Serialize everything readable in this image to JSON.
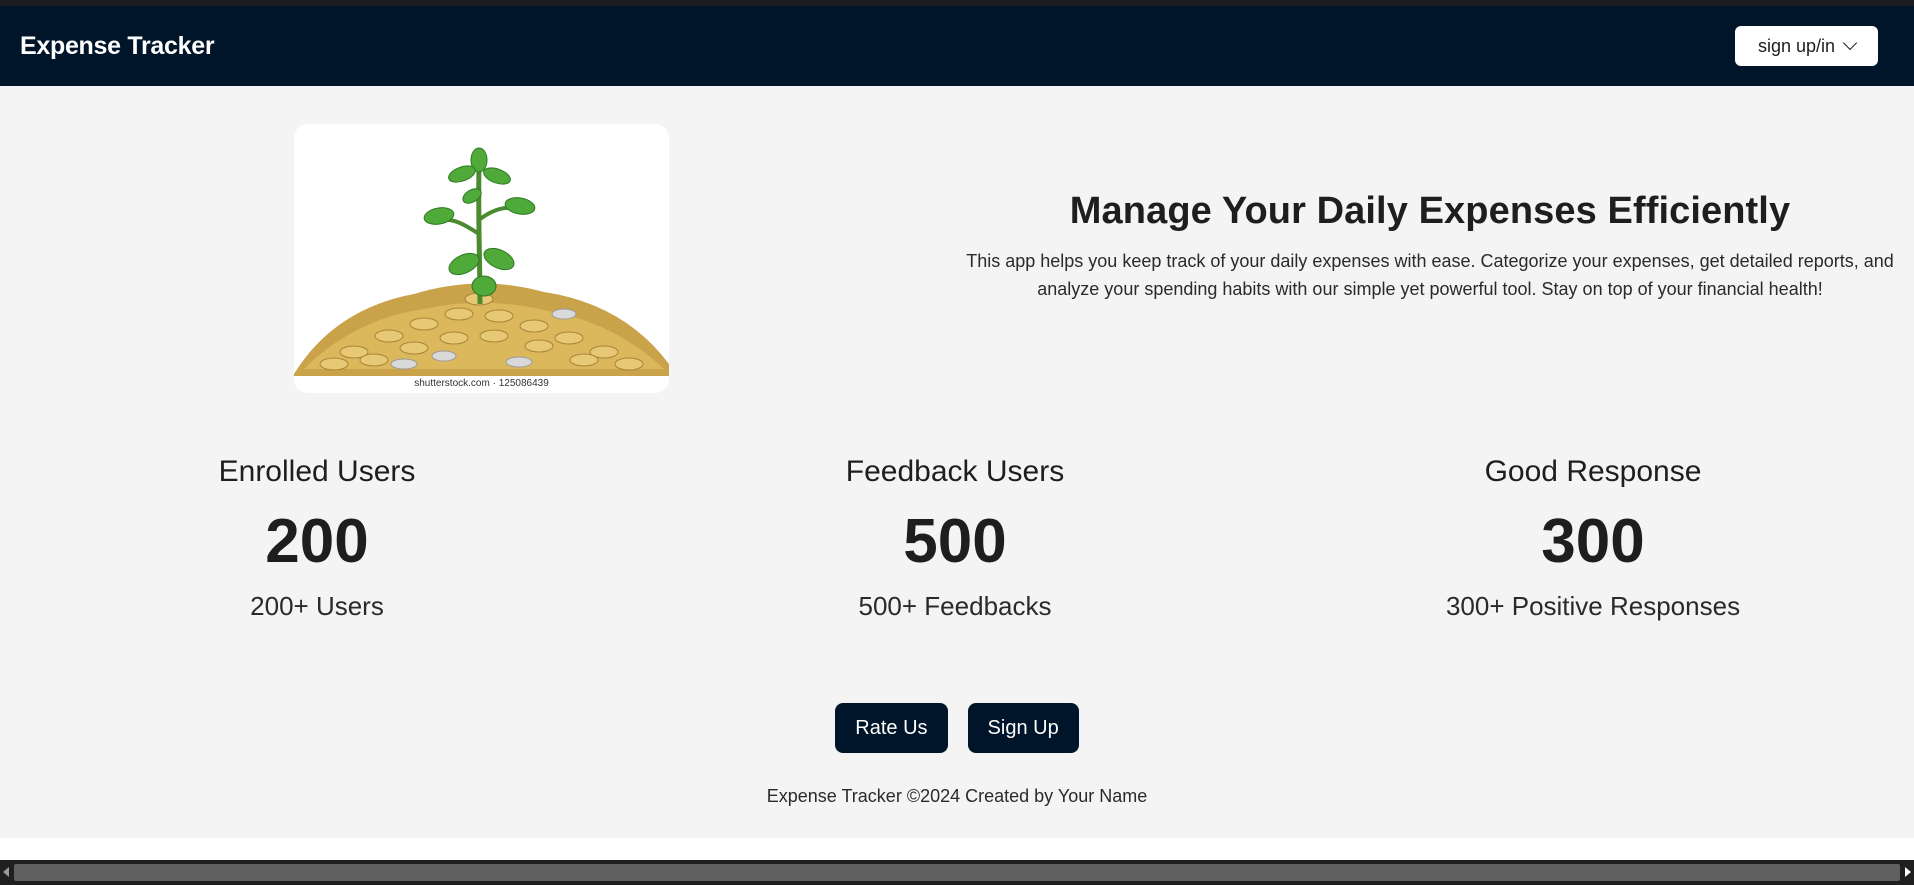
{
  "navbar": {
    "brand": "Expense Tracker",
    "auth_menu_label": "sign up/in"
  },
  "hero": {
    "image_caption": "shutterstock.com · 125086439",
    "title": "Manage Your Daily Expenses Efficiently",
    "description": "This app helps you keep track of your daily expenses with ease. Categorize your expenses, get detailed reports, and analyze your spending habits with our simple yet powerful tool. Stay on top of your financial health!"
  },
  "stats": [
    {
      "label": "Enrolled Users",
      "value": "200",
      "sub": "200+ Users"
    },
    {
      "label": "Feedback Users",
      "value": "500",
      "sub": "500+ Feedbacks"
    },
    {
      "label": "Good Response",
      "value": "300",
      "sub": "300+ Positive Responses"
    }
  ],
  "actions": {
    "rate_label": "Rate Us",
    "signup_label": "Sign Up"
  },
  "footer": {
    "text": "Expense Tracker ©2024 Created by Your Name"
  },
  "colors": {
    "navbar_bg": "#001529",
    "page_bg": "#f4f4f4",
    "button_bg": "#001529"
  },
  "icons": {
    "auth_menu": "chevron-down-icon",
    "scroll_left": "caret-left-icon",
    "scroll_right": "caret-right-icon"
  }
}
